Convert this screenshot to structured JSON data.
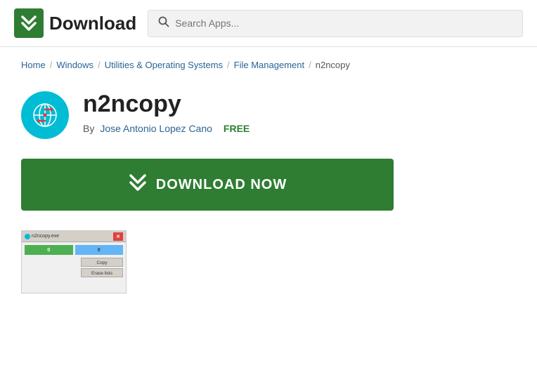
{
  "header": {
    "logo_text": "Download",
    "search_placeholder": "Search Apps..."
  },
  "breadcrumb": {
    "items": [
      {
        "label": "Home",
        "href": "#",
        "type": "link"
      },
      {
        "label": "/",
        "type": "sep"
      },
      {
        "label": "Windows",
        "href": "#",
        "type": "link"
      },
      {
        "label": "/",
        "type": "sep"
      },
      {
        "label": "Utilities & Operating Systems",
        "href": "#",
        "type": "link"
      },
      {
        "label": "/",
        "type": "sep"
      },
      {
        "label": "File Management",
        "href": "#",
        "type": "link"
      },
      {
        "label": "/",
        "type": "sep"
      },
      {
        "label": "n2ncopy",
        "type": "current"
      }
    ]
  },
  "app": {
    "name": "n2ncopy",
    "author_label": "By",
    "author_name": "Jose Antonio Lopez Cano",
    "price": "FREE",
    "download_button": "DOWNLOAD NOW"
  },
  "screenshot": {
    "title_bar_text": "n2ncopy.exe",
    "progress_left": "0",
    "progress_right": "0",
    "btn_copy": "Copy",
    "btn_erase": "Erase lists"
  }
}
